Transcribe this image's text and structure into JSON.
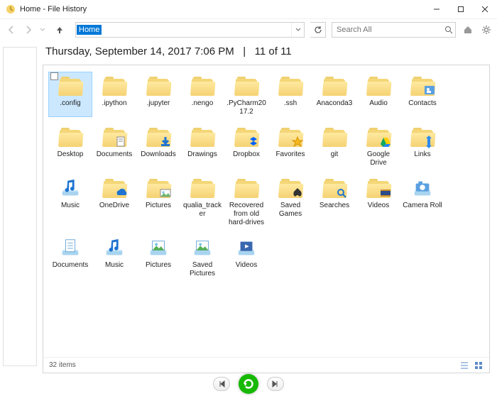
{
  "window": {
    "title": "Home - File History"
  },
  "toolbar": {
    "address": "Home",
    "search_placeholder": "Search All"
  },
  "header": {
    "timestamp": "Thursday, September 14, 2017 7:06 PM",
    "separator": "|",
    "position": "11 of 11"
  },
  "status": {
    "count": "32 items"
  },
  "items": [
    {
      "label": ".config",
      "icon": "folder",
      "selected": true
    },
    {
      "label": ".ipython",
      "icon": "folder"
    },
    {
      "label": ".jupyter",
      "icon": "folder"
    },
    {
      "label": ".nengo",
      "icon": "folder"
    },
    {
      "label": ".PyCharm2017.2",
      "icon": "folder"
    },
    {
      "label": ".ssh",
      "icon": "folder"
    },
    {
      "label": "Anaconda3",
      "icon": "folder"
    },
    {
      "label": "Audio",
      "icon": "folder"
    },
    {
      "label": "Contacts",
      "icon": "folder-contacts"
    },
    {
      "label": "Desktop",
      "icon": "folder"
    },
    {
      "label": "Documents",
      "icon": "folder-documents"
    },
    {
      "label": "Downloads",
      "icon": "folder-downloads"
    },
    {
      "label": "Drawings",
      "icon": "folder"
    },
    {
      "label": "Dropbox",
      "icon": "folder-dropbox"
    },
    {
      "label": "Favorites",
      "icon": "folder-favorites"
    },
    {
      "label": "git",
      "icon": "folder"
    },
    {
      "label": "Google Drive",
      "icon": "folder-gdrive"
    },
    {
      "label": "Links",
      "icon": "folder-links"
    },
    {
      "label": "Music",
      "icon": "lib-music"
    },
    {
      "label": "OneDrive",
      "icon": "folder-onedrive"
    },
    {
      "label": "Pictures",
      "icon": "folder-pictures"
    },
    {
      "label": "qualia_tracker",
      "icon": "folder"
    },
    {
      "label": "Recovered from old hard-drives",
      "icon": "folder"
    },
    {
      "label": "Saved Games",
      "icon": "folder-games"
    },
    {
      "label": "Searches",
      "icon": "folder-searches"
    },
    {
      "label": "Videos",
      "icon": "folder-videos"
    },
    {
      "label": "Camera Roll",
      "icon": "lib-camera"
    },
    {
      "label": "Documents",
      "icon": "lib-documents"
    },
    {
      "label": "Music",
      "icon": "lib-music"
    },
    {
      "label": "Pictures",
      "icon": "lib-pictures"
    },
    {
      "label": "Saved Pictures",
      "icon": "lib-pictures"
    },
    {
      "label": "Videos",
      "icon": "lib-videos"
    }
  ]
}
